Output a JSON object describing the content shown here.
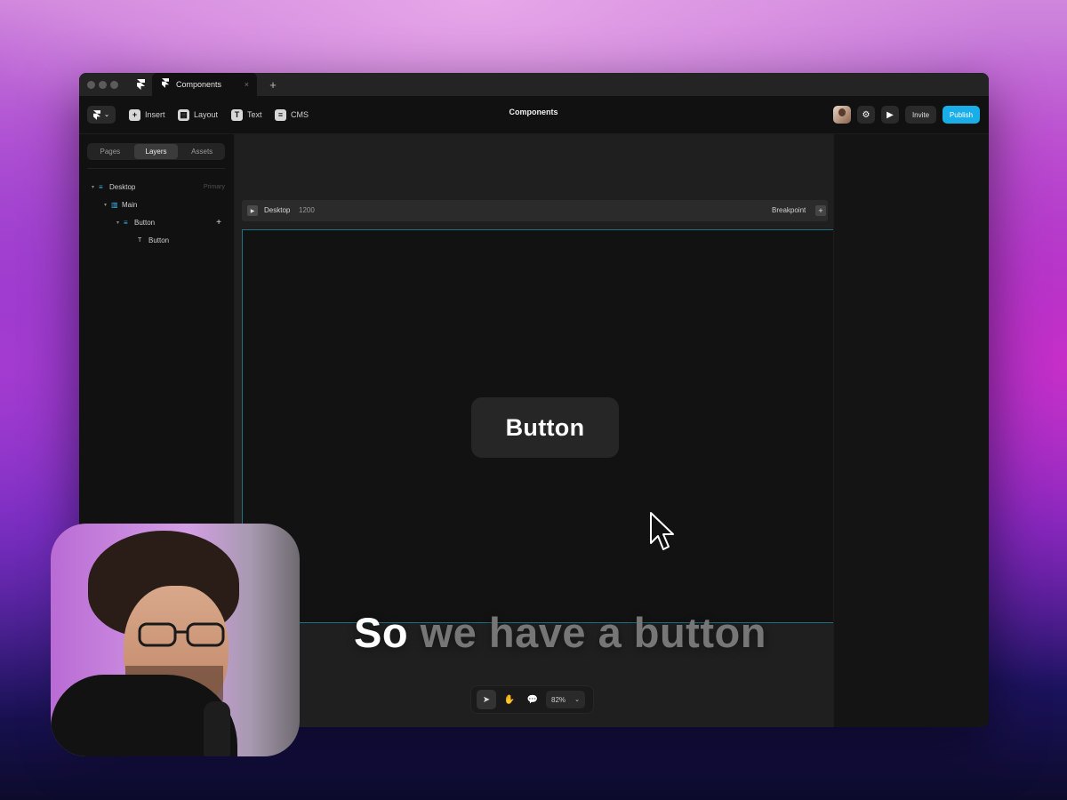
{
  "window": {
    "tab_title": "Components",
    "new_tab": "+",
    "tab_close": "×"
  },
  "toolbar": {
    "insert": "Insert",
    "layout": "Layout",
    "text": "Text",
    "cms": "CMS",
    "title": "Components",
    "invite": "Invite",
    "publish": "Publish"
  },
  "left_panel": {
    "tabs": [
      {
        "label": "Pages",
        "active": false
      },
      {
        "label": "Layers",
        "active": true
      },
      {
        "label": "Assets",
        "active": false
      }
    ],
    "layers": [
      {
        "label": "Desktop",
        "sub": "Primary",
        "icon": "stack-icon"
      },
      {
        "label": "Main",
        "icon": "columns-icon"
      },
      {
        "label": "Button",
        "icon": "stack-icon",
        "action": "+"
      },
      {
        "label": "Button",
        "icon": "text-icon"
      }
    ]
  },
  "canvas": {
    "breakpoint_title": "Desktop",
    "breakpoint_width": "1200",
    "breakpoint_label": "Breakpoint",
    "breakpoint_add": "+",
    "button_text": "Button",
    "zoom": "82%"
  },
  "caption": {
    "spoken": "So",
    "upcoming": "we have a button"
  },
  "colors": {
    "accent": "#1aaee8",
    "frame_border": "#1f6f86",
    "layer_icon": "#3fb6e8"
  }
}
